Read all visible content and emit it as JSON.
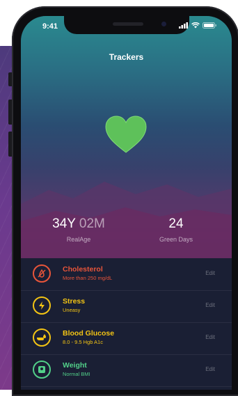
{
  "status": {
    "time": "9:41"
  },
  "header": {
    "title": "Trackers"
  },
  "stats": {
    "real_age_major": "34Y",
    "real_age_minor": "02M",
    "real_age_label": "RealAge",
    "green_days_value": "24",
    "green_days_label": "Green Days"
  },
  "trackers": [
    {
      "name": "Cholesterol",
      "detail": "More than 250 mg/dL",
      "edit": "Edit",
      "icon": "no-fat-icon",
      "color": "#e8553a"
    },
    {
      "name": "Stress",
      "detail": "Uneasy",
      "edit": "Edit",
      "icon": "lightning-icon",
      "color": "#f3c414"
    },
    {
      "name": "Blood Glucose",
      "detail": "8.0 - 9.5 Hgb A1c",
      "edit": "Edit",
      "icon": "finger-prick-icon",
      "color": "#f3c414"
    },
    {
      "name": "Weight",
      "detail": "Normal BMI",
      "edit": "Edit",
      "icon": "scale-icon",
      "color": "#52d089"
    }
  ],
  "colors": {
    "heart": "#5ec15a",
    "list_bg": "#1a1f34"
  }
}
